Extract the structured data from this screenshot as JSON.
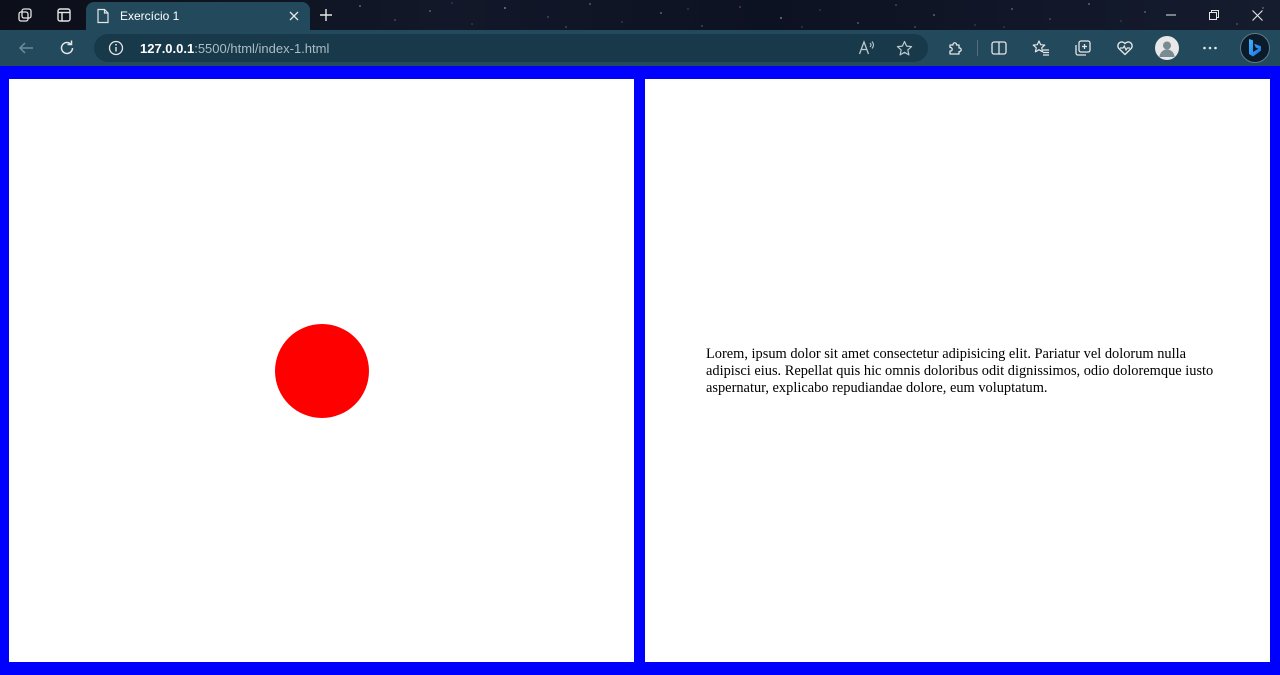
{
  "browser": {
    "tab": {
      "title": "Exercício 1"
    },
    "address": {
      "host": "127.0.0.1",
      "rest": ":5500/html/index-1.html"
    },
    "colors": {
      "titlebar": "#121829",
      "toolbar": "#224a5c",
      "address_bar": "#183949"
    }
  },
  "page": {
    "background_color": "#0000ff",
    "panel_color": "#ffffff",
    "circle_color": "#ff0000",
    "paragraph": "Lorem, ipsum dolor sit amet consectetur adipisicing elit. Pariatur vel dolorum nulla adipisci eius. Repellat quis hic omnis doloribus odit dignissimos, odio doloremque iusto aspernatur, explicabo repudiandae dolore, eum voluptatum."
  },
  "icons": {
    "workspaces": "workspaces-icon",
    "tab_actions": "tab-actions-icon",
    "page": "page-icon",
    "close": "close-icon",
    "new_tab": "plus-icon",
    "back": "back-arrow-icon",
    "refresh": "refresh-icon",
    "info": "info-icon",
    "read_aloud": "read-aloud-icon",
    "favorite": "star-icon",
    "extensions": "puzzle-icon",
    "split_screen": "split-screen-icon",
    "favorites": "favorites-icon",
    "collections": "collections-icon",
    "health": "heart-icon",
    "profile": "profile-icon",
    "more": "more-icon",
    "copilot": "bing-icon"
  }
}
